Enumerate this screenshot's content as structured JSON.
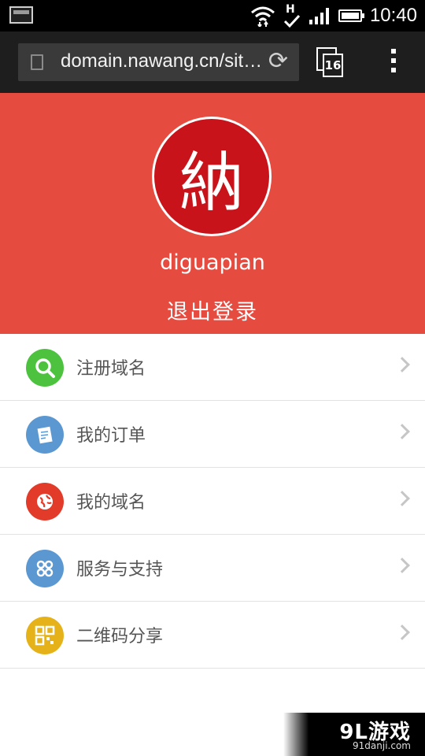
{
  "status_bar": {
    "time": "10:40",
    "network_label": "H",
    "icons": [
      "screenshot-icon",
      "wifi-icon",
      "network-h-icon",
      "signal-icon",
      "battery-icon"
    ]
  },
  "browser": {
    "url": "domain.nawang.cn/sit…",
    "tab_count": "16",
    "icons": [
      "page-icon",
      "reload-icon",
      "tabs-icon",
      "overflow-menu-icon"
    ]
  },
  "profile": {
    "avatar_glyph": "納",
    "username": "diguapian",
    "logout_label": "退出登录",
    "background_color": "#e64b40"
  },
  "menu": {
    "items": [
      {
        "label": "注册域名",
        "icon": "search-icon",
        "icon_glyph": "⌕",
        "color": "#4cc23f"
      },
      {
        "label": "我的订单",
        "icon": "order-icon",
        "icon_glyph": "✎",
        "color": "#5b98d2"
      },
      {
        "label": "我的域名",
        "icon": "globe-icon",
        "icon_glyph": "◉",
        "color": "#e23b2a"
      },
      {
        "label": "服务与支持",
        "icon": "service-icon",
        "icon_glyph": "⌘",
        "color": "#5b98d2"
      },
      {
        "label": "二维码分享",
        "icon": "qrcode-icon",
        "icon_glyph": "▦",
        "color": "#e5b219"
      }
    ]
  },
  "watermark": {
    "main": "9L游戏",
    "sub": "91danji.com"
  }
}
